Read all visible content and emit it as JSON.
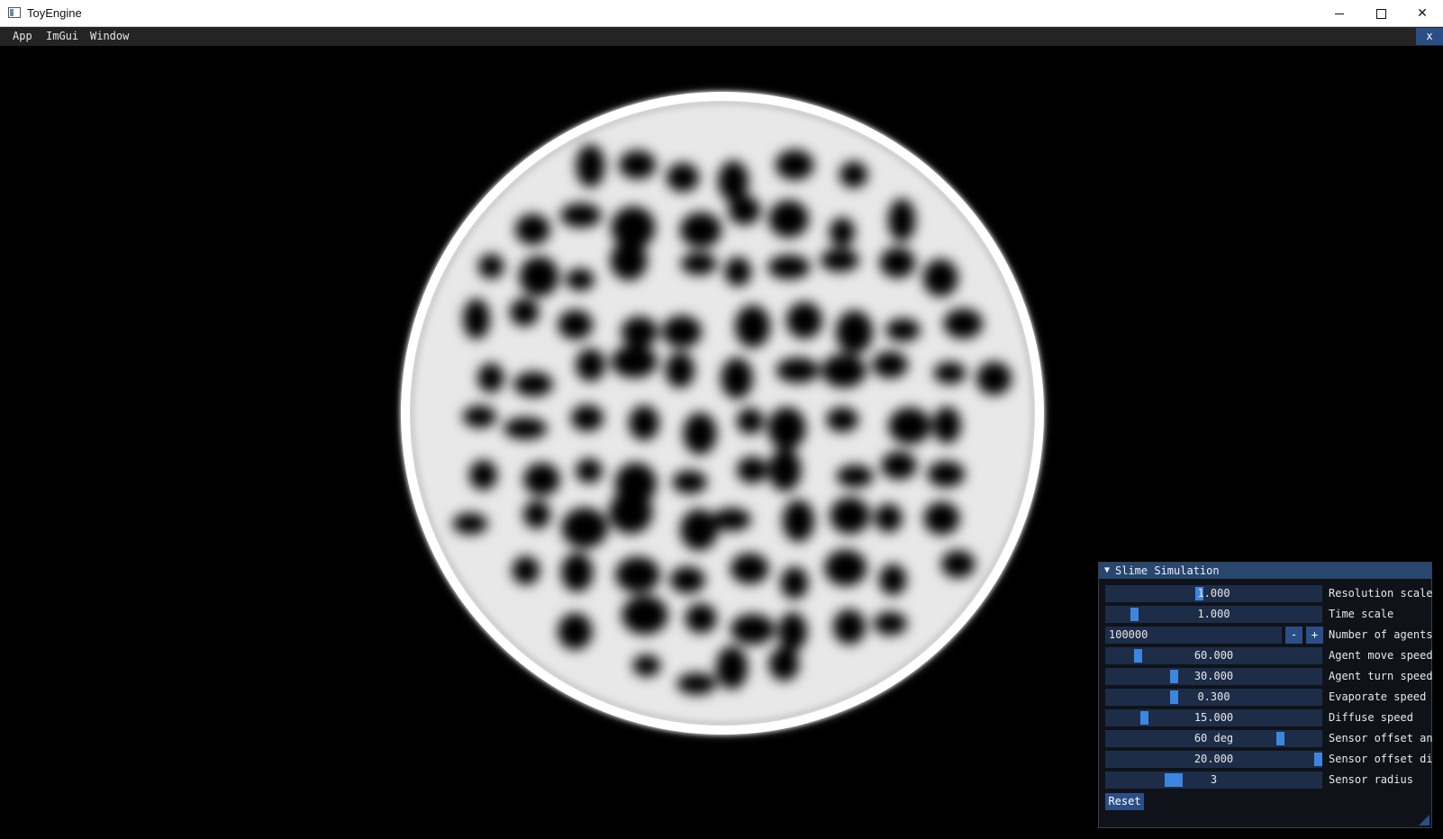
{
  "window": {
    "title": "ToyEngine",
    "close_glyph": "✕"
  },
  "menubar": {
    "items": [
      "App",
      "ImGui",
      "Window"
    ],
    "close_label": "x"
  },
  "panel": {
    "title": "Slime Simulation",
    "collapse_glyph": "▼",
    "controls": [
      {
        "label": "Resolution scale",
        "value": "1.000",
        "fraction": 0.43
      },
      {
        "label": "Time scale",
        "value": "1.000",
        "fraction": 0.12
      },
      {
        "label": "Number of agents",
        "value": "100000",
        "minus": "-",
        "plus": "+"
      },
      {
        "label": "Agent move speed",
        "value": "60.000",
        "fraction": 0.14
      },
      {
        "label": "Agent turn speed",
        "value": "30.000",
        "fraction": 0.31
      },
      {
        "label": "Evaporate speed",
        "value": "0.300",
        "fraction": 0.31
      },
      {
        "label": "Diffuse speed",
        "value": "15.000",
        "fraction": 0.17
      },
      {
        "label": "Sensor offset angle",
        "value": "60 deg",
        "fraction": 0.82
      },
      {
        "label": "Sensor offset distance",
        "value": "20.000",
        "fraction": 1.0
      },
      {
        "label": "Sensor radius",
        "value": "3",
        "fraction": 0.3
      }
    ],
    "reset_label": "Reset"
  },
  "colors": {
    "menubar_bg": "#242424",
    "panel_header": "#28466e",
    "slider_bg": "#1d2d48",
    "slider_grab": "#3d86e0",
    "button": "#2a4f86"
  }
}
